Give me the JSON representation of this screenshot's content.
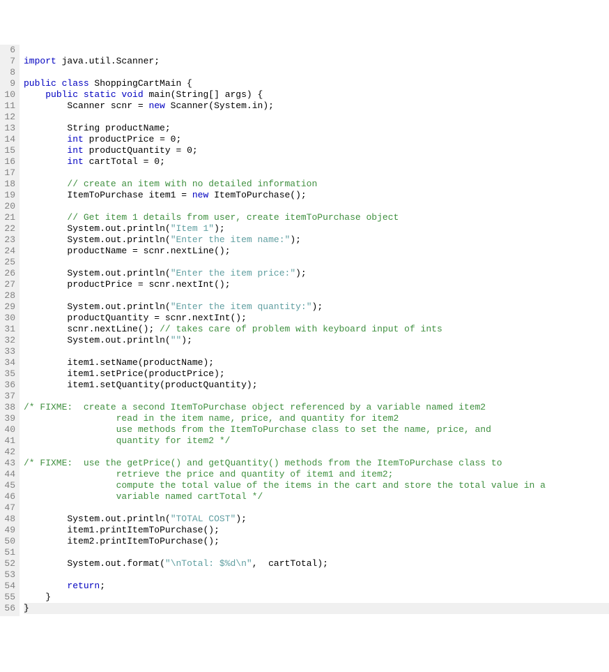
{
  "first_line_number": 6,
  "lines": [
    {
      "n": 6,
      "tokens": []
    },
    {
      "n": 7,
      "tokens": [
        {
          "t": "import ",
          "c": "kw"
        },
        {
          "t": "java.util.Scanner;",
          "c": "id"
        }
      ]
    },
    {
      "n": 8,
      "tokens": []
    },
    {
      "n": 9,
      "tokens": [
        {
          "t": "public class ",
          "c": "kw"
        },
        {
          "t": "ShoppingCartMain ",
          "c": "id"
        },
        {
          "t": "{",
          "c": "punc"
        }
      ]
    },
    {
      "n": 10,
      "indent": 1,
      "tokens": [
        {
          "t": "public static void ",
          "c": "kw"
        },
        {
          "t": "main",
          "c": "id"
        },
        {
          "t": "(",
          "c": "punc"
        },
        {
          "t": "String",
          "c": "id"
        },
        {
          "t": "[] ",
          "c": "punc"
        },
        {
          "t": "args",
          "c": "id"
        },
        {
          "t": ") {",
          "c": "punc"
        }
      ]
    },
    {
      "n": 11,
      "indent": 2,
      "tokens": [
        {
          "t": "Scanner scnr ",
          "c": "id"
        },
        {
          "t": "= ",
          "c": "op"
        },
        {
          "t": "new ",
          "c": "kw"
        },
        {
          "t": "Scanner",
          "c": "id"
        },
        {
          "t": "(",
          "c": "punc"
        },
        {
          "t": "System",
          "c": "id"
        },
        {
          "t": ".",
          "c": "punc"
        },
        {
          "t": "in",
          "c": "id"
        },
        {
          "t": ");",
          "c": "punc"
        }
      ]
    },
    {
      "n": 12,
      "tokens": []
    },
    {
      "n": 13,
      "indent": 2,
      "tokens": [
        {
          "t": "String ",
          "c": "id"
        },
        {
          "t": "productName;",
          "c": "id"
        }
      ]
    },
    {
      "n": 14,
      "indent": 2,
      "tokens": [
        {
          "t": "int ",
          "c": "kw"
        },
        {
          "t": "productPrice ",
          "c": "id"
        },
        {
          "t": "= ",
          "c": "op"
        },
        {
          "t": "0",
          "c": "num"
        },
        {
          "t": ";",
          "c": "punc"
        }
      ]
    },
    {
      "n": 15,
      "indent": 2,
      "tokens": [
        {
          "t": "int ",
          "c": "kw"
        },
        {
          "t": "productQuantity ",
          "c": "id"
        },
        {
          "t": "= ",
          "c": "op"
        },
        {
          "t": "0",
          "c": "num"
        },
        {
          "t": ";",
          "c": "punc"
        }
      ]
    },
    {
      "n": 16,
      "indent": 2,
      "tokens": [
        {
          "t": "int ",
          "c": "kw"
        },
        {
          "t": "cartTotal ",
          "c": "id"
        },
        {
          "t": "= ",
          "c": "op"
        },
        {
          "t": "0",
          "c": "num"
        },
        {
          "t": ";",
          "c": "punc"
        }
      ]
    },
    {
      "n": 17,
      "tokens": []
    },
    {
      "n": 18,
      "indent": 2,
      "tokens": [
        {
          "t": "// create an item with no detailed information",
          "c": "cmt"
        }
      ]
    },
    {
      "n": 19,
      "indent": 2,
      "tokens": [
        {
          "t": "ItemToPurchase item1 ",
          "c": "id"
        },
        {
          "t": "= ",
          "c": "op"
        },
        {
          "t": "new ",
          "c": "kw"
        },
        {
          "t": "ItemToPurchase",
          "c": "id"
        },
        {
          "t": "();",
          "c": "punc"
        }
      ]
    },
    {
      "n": 20,
      "tokens": []
    },
    {
      "n": 21,
      "indent": 2,
      "tokens": [
        {
          "t": "// Get item 1 details from user, create itemToPurchase object",
          "c": "cmt"
        }
      ]
    },
    {
      "n": 22,
      "indent": 2,
      "tokens": [
        {
          "t": "System",
          "c": "id"
        },
        {
          "t": ".",
          "c": "punc"
        },
        {
          "t": "out",
          "c": "id"
        },
        {
          "t": ".",
          "c": "punc"
        },
        {
          "t": "println",
          "c": "id"
        },
        {
          "t": "(",
          "c": "punc"
        },
        {
          "t": "\"Item 1\"",
          "c": "str"
        },
        {
          "t": ");",
          "c": "punc"
        }
      ]
    },
    {
      "n": 23,
      "indent": 2,
      "tokens": [
        {
          "t": "System",
          "c": "id"
        },
        {
          "t": ".",
          "c": "punc"
        },
        {
          "t": "out",
          "c": "id"
        },
        {
          "t": ".",
          "c": "punc"
        },
        {
          "t": "println",
          "c": "id"
        },
        {
          "t": "(",
          "c": "punc"
        },
        {
          "t": "\"Enter the item name:\"",
          "c": "str"
        },
        {
          "t": ");",
          "c": "punc"
        }
      ]
    },
    {
      "n": 24,
      "indent": 2,
      "tokens": [
        {
          "t": "productName ",
          "c": "id"
        },
        {
          "t": "= ",
          "c": "op"
        },
        {
          "t": "scnr",
          "c": "id"
        },
        {
          "t": ".",
          "c": "punc"
        },
        {
          "t": "nextLine",
          "c": "id"
        },
        {
          "t": "();",
          "c": "punc"
        }
      ]
    },
    {
      "n": 25,
      "tokens": []
    },
    {
      "n": 26,
      "indent": 2,
      "tokens": [
        {
          "t": "System",
          "c": "id"
        },
        {
          "t": ".",
          "c": "punc"
        },
        {
          "t": "out",
          "c": "id"
        },
        {
          "t": ".",
          "c": "punc"
        },
        {
          "t": "println",
          "c": "id"
        },
        {
          "t": "(",
          "c": "punc"
        },
        {
          "t": "\"Enter the item price:\"",
          "c": "str"
        },
        {
          "t": ");",
          "c": "punc"
        }
      ]
    },
    {
      "n": 27,
      "indent": 2,
      "tokens": [
        {
          "t": "productPrice ",
          "c": "id"
        },
        {
          "t": "= ",
          "c": "op"
        },
        {
          "t": "scnr",
          "c": "id"
        },
        {
          "t": ".",
          "c": "punc"
        },
        {
          "t": "nextInt",
          "c": "id"
        },
        {
          "t": "();",
          "c": "punc"
        }
      ]
    },
    {
      "n": 28,
      "tokens": []
    },
    {
      "n": 29,
      "indent": 2,
      "tokens": [
        {
          "t": "System",
          "c": "id"
        },
        {
          "t": ".",
          "c": "punc"
        },
        {
          "t": "out",
          "c": "id"
        },
        {
          "t": ".",
          "c": "punc"
        },
        {
          "t": "println",
          "c": "id"
        },
        {
          "t": "(",
          "c": "punc"
        },
        {
          "t": "\"Enter the item quantity:\"",
          "c": "str"
        },
        {
          "t": ");",
          "c": "punc"
        }
      ]
    },
    {
      "n": 30,
      "indent": 2,
      "tokens": [
        {
          "t": "productQuantity ",
          "c": "id"
        },
        {
          "t": "= ",
          "c": "op"
        },
        {
          "t": "scnr",
          "c": "id"
        },
        {
          "t": ".",
          "c": "punc"
        },
        {
          "t": "nextInt",
          "c": "id"
        },
        {
          "t": "();",
          "c": "punc"
        }
      ]
    },
    {
      "n": 31,
      "indent": 2,
      "tokens": [
        {
          "t": "scnr",
          "c": "id"
        },
        {
          "t": ".",
          "c": "punc"
        },
        {
          "t": "nextLine",
          "c": "id"
        },
        {
          "t": "(); ",
          "c": "punc"
        },
        {
          "t": "// takes care of problem with keyboard input of ints",
          "c": "cmt"
        }
      ]
    },
    {
      "n": 32,
      "indent": 2,
      "tokens": [
        {
          "t": "System",
          "c": "id"
        },
        {
          "t": ".",
          "c": "punc"
        },
        {
          "t": "out",
          "c": "id"
        },
        {
          "t": ".",
          "c": "punc"
        },
        {
          "t": "println",
          "c": "id"
        },
        {
          "t": "(",
          "c": "punc"
        },
        {
          "t": "\"\"",
          "c": "str"
        },
        {
          "t": ");",
          "c": "punc"
        }
      ]
    },
    {
      "n": 33,
      "tokens": []
    },
    {
      "n": 34,
      "indent": 2,
      "tokens": [
        {
          "t": "item1",
          "c": "id"
        },
        {
          "t": ".",
          "c": "punc"
        },
        {
          "t": "setName",
          "c": "id"
        },
        {
          "t": "(",
          "c": "punc"
        },
        {
          "t": "productName",
          "c": "id"
        },
        {
          "t": ");",
          "c": "punc"
        }
      ]
    },
    {
      "n": 35,
      "indent": 2,
      "tokens": [
        {
          "t": "item1",
          "c": "id"
        },
        {
          "t": ".",
          "c": "punc"
        },
        {
          "t": "setPrice",
          "c": "id"
        },
        {
          "t": "(",
          "c": "punc"
        },
        {
          "t": "productPrice",
          "c": "id"
        },
        {
          "t": ");",
          "c": "punc"
        }
      ]
    },
    {
      "n": 36,
      "indent": 2,
      "tokens": [
        {
          "t": "item1",
          "c": "id"
        },
        {
          "t": ".",
          "c": "punc"
        },
        {
          "t": "setQuantity",
          "c": "id"
        },
        {
          "t": "(",
          "c": "punc"
        },
        {
          "t": "productQuantity",
          "c": "id"
        },
        {
          "t": ");",
          "c": "punc"
        }
      ]
    },
    {
      "n": 37,
      "tokens": []
    },
    {
      "n": 38,
      "tokens": [
        {
          "t": "/* FIXME:  create a second ItemToPurchase object referenced by a variable named item2",
          "c": "cmt"
        }
      ]
    },
    {
      "n": 39,
      "tokens": [
        {
          "t": "                 read in the item name, price, and quantity for item2",
          "c": "cmt"
        }
      ]
    },
    {
      "n": 40,
      "tokens": [
        {
          "t": "                 use methods from the ItemToPurchase class to set the name, price, and",
          "c": "cmt"
        }
      ]
    },
    {
      "n": 41,
      "tokens": [
        {
          "t": "                 quantity for item2 */",
          "c": "cmt"
        }
      ]
    },
    {
      "n": 42,
      "tokens": []
    },
    {
      "n": 43,
      "tokens": [
        {
          "t": "/* FIXME:  use the getPrice() and getQuantity() methods from the ItemToPurchase class to",
          "c": "cmt"
        }
      ]
    },
    {
      "n": 44,
      "tokens": [
        {
          "t": "                 retrieve the price and quantity of item1 and item2;",
          "c": "cmt"
        }
      ]
    },
    {
      "n": 45,
      "tokens": [
        {
          "t": "                 compute the total value of the items in the cart and store the total value in a",
          "c": "cmt"
        }
      ]
    },
    {
      "n": 46,
      "tokens": [
        {
          "t": "                 variable named cartTotal */",
          "c": "cmt"
        }
      ]
    },
    {
      "n": 47,
      "tokens": []
    },
    {
      "n": 48,
      "indent": 2,
      "tokens": [
        {
          "t": "System",
          "c": "id"
        },
        {
          "t": ".",
          "c": "punc"
        },
        {
          "t": "out",
          "c": "id"
        },
        {
          "t": ".",
          "c": "punc"
        },
        {
          "t": "println",
          "c": "id"
        },
        {
          "t": "(",
          "c": "punc"
        },
        {
          "t": "\"TOTAL COST\"",
          "c": "str"
        },
        {
          "t": ");",
          "c": "punc"
        }
      ]
    },
    {
      "n": 49,
      "indent": 2,
      "tokens": [
        {
          "t": "item1",
          "c": "id"
        },
        {
          "t": ".",
          "c": "punc"
        },
        {
          "t": "printItemToPurchase",
          "c": "id"
        },
        {
          "t": "();",
          "c": "punc"
        }
      ]
    },
    {
      "n": 50,
      "indent": 2,
      "tokens": [
        {
          "t": "item2",
          "c": "id"
        },
        {
          "t": ".",
          "c": "punc"
        },
        {
          "t": "printItemToPurchase",
          "c": "id"
        },
        {
          "t": "();",
          "c": "punc"
        }
      ]
    },
    {
      "n": 51,
      "tokens": []
    },
    {
      "n": 52,
      "indent": 2,
      "tokens": [
        {
          "t": "System",
          "c": "id"
        },
        {
          "t": ".",
          "c": "punc"
        },
        {
          "t": "out",
          "c": "id"
        },
        {
          "t": ".",
          "c": "punc"
        },
        {
          "t": "format",
          "c": "id"
        },
        {
          "t": "(",
          "c": "punc"
        },
        {
          "t": "\"\\nTotal: $%d\\n\"",
          "c": "str"
        },
        {
          "t": ",  ",
          "c": "punc"
        },
        {
          "t": "cartTotal",
          "c": "id"
        },
        {
          "t": ");",
          "c": "punc"
        }
      ]
    },
    {
      "n": 53,
      "tokens": []
    },
    {
      "n": 54,
      "indent": 2,
      "tokens": [
        {
          "t": "return",
          "c": "kw"
        },
        {
          "t": ";",
          "c": "punc"
        }
      ]
    },
    {
      "n": 55,
      "indent": 1,
      "tokens": [
        {
          "t": "}",
          "c": "punc"
        }
      ]
    },
    {
      "n": 56,
      "hl": true,
      "tokens": [
        {
          "t": "}",
          "c": "punc"
        }
      ]
    }
  ],
  "indent_unit": "    "
}
